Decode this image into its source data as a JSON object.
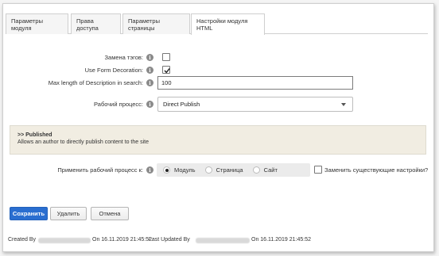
{
  "tabs": [
    {
      "label": "Параметры модуля"
    },
    {
      "label": "Права доступа"
    },
    {
      "label": "Параметры страницы"
    },
    {
      "label": "Настройки модуля HTML"
    }
  ],
  "form": {
    "replace_tags_label": "Замена тэгов:",
    "replace_tags_checked": false,
    "form_decoration_label": "Use Form Decoration:",
    "form_decoration_checked": true,
    "max_length_label": "Max length of Description in search:",
    "max_length_value": "100",
    "workflow_label": "Рабочий процесс:",
    "workflow_value": "Direct Publish"
  },
  "info_panel": {
    "title": ">> Published",
    "text": "Allows an author to directly publish content to the site"
  },
  "apply_workflow": {
    "label": "Применить рабочий процесс к:",
    "options": [
      "Модуль",
      "Страница",
      "Сайт"
    ],
    "selected": "Модуль",
    "replace_label": "Заменить существующие настройки?",
    "replace_checked": false
  },
  "buttons": {
    "save": "Сохранить",
    "delete": "Удалить",
    "cancel": "Отмена"
  },
  "footer": {
    "created_by": "Created By",
    "created_on": "On 16.11.2019 21:45:52",
    "updated_by": "Last Updated By",
    "updated_on": "On 16.11.2019 21:45:52"
  },
  "colors": {
    "primary_button": "#2a6ed0",
    "panel_bg": "#f1ede2"
  }
}
